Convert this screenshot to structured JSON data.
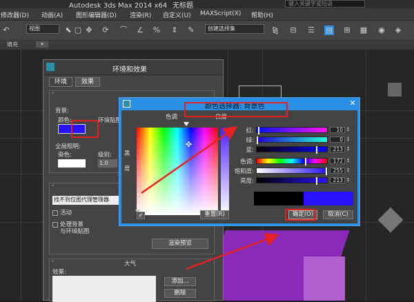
{
  "titlebar": {
    "app": "Autodesk 3ds Max  2014 x64",
    "doc": "无标题",
    "search_placeholder": "键入关键字或短语"
  },
  "menu": [
    "修改器(D)",
    "动画(A)",
    "图形编辑器(D)",
    "渲染(R)",
    "自定义(U)",
    "MAXScript(X)",
    "帮助(H)"
  ],
  "toolbar": {
    "view_select": "视图",
    "selection_set": "创建选择集"
  },
  "ribbon": {
    "label": "填充"
  },
  "env_dialog": {
    "title": "环境和效果",
    "tabs": [
      "环境",
      "效果"
    ],
    "background_label": "背景:",
    "color_label": "颜色:",
    "env_map_label": "环境贴图:",
    "global_lighting_label": "全局照明:",
    "tint_label": "染色:",
    "level_label": "级别:",
    "level_value": "1.0",
    "bg_color": "#2a12ff",
    "proxy_manager": "找不到位图代理管理器",
    "active_label": "活动",
    "process_bg_label": "处理背景",
    "process_bg_label2": "与环境贴图",
    "render_preview": "渲染预览",
    "atmosphere_title": "大气",
    "effects_label": "效果:",
    "add_button": "添加...",
    "delete_button": "删除"
  },
  "color_picker": {
    "title": "颜色选择器: 背景色",
    "hue_label": "色调",
    "whiteness_label": "白度",
    "blackness_label": "黑\n度",
    "reset_button": "重置(R)",
    "ok_button": "确定(O)",
    "cancel_button": "取消(C)",
    "sliders": [
      {
        "label": "红:",
        "value": "10"
      },
      {
        "label": "绿:",
        "value": "0"
      },
      {
        "label": "蓝:",
        "value": "213"
      },
      {
        "label": "色调:",
        "value": "172"
      },
      {
        "label": "饱和度:",
        "value": "255"
      },
      {
        "label": "亮度:",
        "value": "213"
      }
    ],
    "new_color": "#2a12ff",
    "old_color": "#000000"
  }
}
